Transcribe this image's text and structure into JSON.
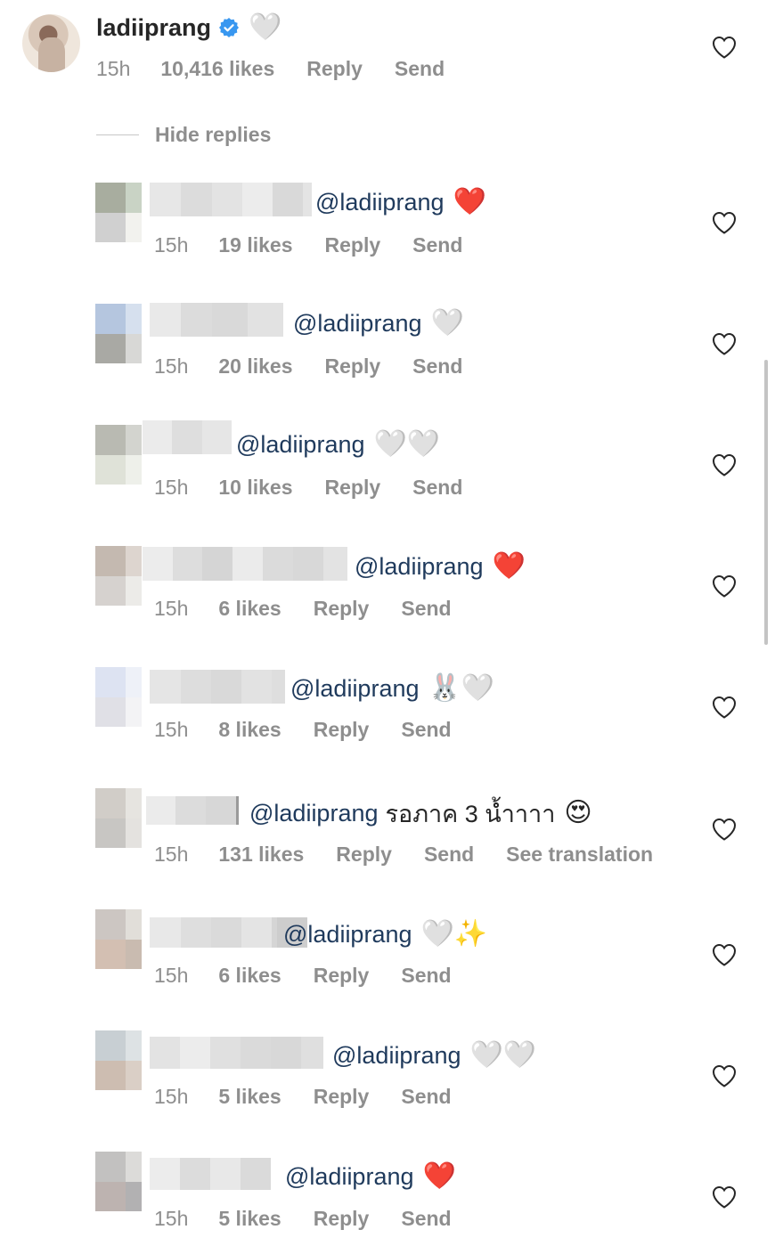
{
  "main_comment": {
    "username": "ladiiprang",
    "time": "15h",
    "likes": "10,416 likes",
    "reply_label": "Reply",
    "send_label": "Send",
    "emoji": "🤍"
  },
  "hide_replies_label": "Hide replies",
  "replies": [
    {
      "mention": "@ladiiprang",
      "text": "",
      "emojis": "❤️",
      "time": "15h",
      "likes": "19 likes",
      "reply_label": "Reply",
      "send_label": "Send"
    },
    {
      "mention": "@ladiiprang",
      "text": "",
      "emojis": "🤍",
      "time": "15h",
      "likes": "20 likes",
      "reply_label": "Reply",
      "send_label": "Send"
    },
    {
      "mention": "@ladiiprang",
      "text": "",
      "emojis": "🤍🤍",
      "time": "15h",
      "likes": "10 likes",
      "reply_label": "Reply",
      "send_label": "Send"
    },
    {
      "mention": "@ladiiprang",
      "text": "",
      "emojis": "❤️",
      "time": "15h",
      "likes": "6 likes",
      "reply_label": "Reply",
      "send_label": "Send"
    },
    {
      "mention": "@ladiiprang",
      "text": "",
      "emojis": "🐰🤍",
      "time": "15h",
      "likes": "8 likes",
      "reply_label": "Reply",
      "send_label": "Send"
    },
    {
      "mention": "@ladiiprang",
      "text": "รอภาค 3 น้ำาาา",
      "emojis": "😍",
      "time": "15h",
      "likes": "131 likes",
      "reply_label": "Reply",
      "send_label": "Send",
      "translation_label": "See translation"
    },
    {
      "mention": "@ladiiprang",
      "text": "",
      "emojis": "🤍✨",
      "time": "15h",
      "likes": "6 likes",
      "reply_label": "Reply",
      "send_label": "Send"
    },
    {
      "mention": "@ladiiprang",
      "text": "",
      "emojis": "🤍🤍",
      "time": "15h",
      "likes": "5 likes",
      "reply_label": "Reply",
      "send_label": "Send"
    },
    {
      "mention": "@ladiiprang",
      "text": "",
      "emojis": "❤️",
      "time": "15h",
      "likes": "5 likes",
      "reply_label": "Reply",
      "send_label": "Send"
    }
  ],
  "colors": {
    "mention": "#1f3a5c",
    "meta_gray": "#8e8e8e",
    "verified_blue": "#3897f0",
    "red_heart": "#e0202e"
  },
  "icons": {
    "like": "heart-outline-icon",
    "verified": "verified-badge-icon"
  }
}
